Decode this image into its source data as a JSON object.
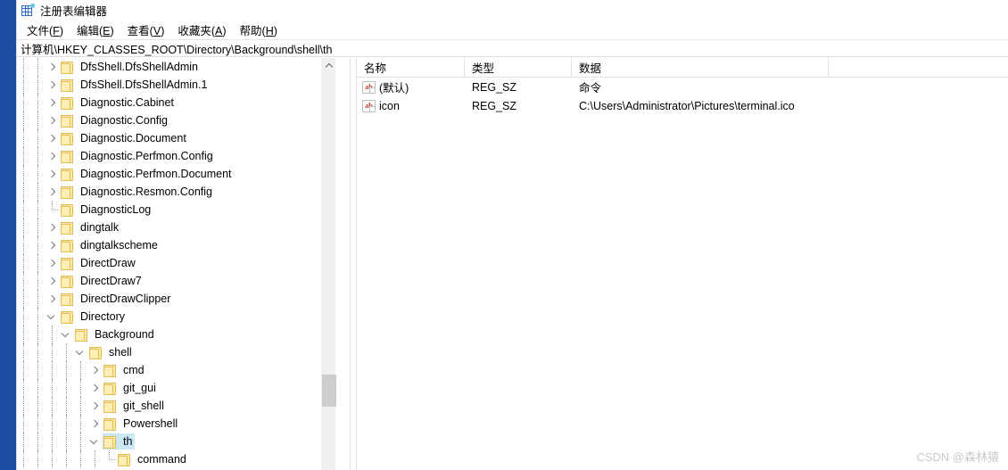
{
  "window": {
    "title": "注册表编辑器",
    "app_icon": "registry-editor-icon"
  },
  "menu": {
    "items": [
      {
        "text": "文件(F)",
        "pre": "文件(",
        "accel": "F",
        "post": ")"
      },
      {
        "text": "编辑(E)",
        "pre": "编辑(",
        "accel": "E",
        "post": ")"
      },
      {
        "text": "查看(V)",
        "pre": "查看(",
        "accel": "V",
        "post": ")"
      },
      {
        "text": "收藏夹(A)",
        "pre": "收藏夹(",
        "accel": "A",
        "post": ")"
      },
      {
        "text": "帮助(H)",
        "pre": "帮助(",
        "accel": "H",
        "post": ")"
      }
    ]
  },
  "address": {
    "path": "计算机\\HKEY_CLASSES_ROOT\\Directory\\Background\\shell\\th"
  },
  "tree": {
    "nodes": [
      {
        "label": "DfsShell.DfsShellAdmin",
        "depth": 2,
        "state": "collapsed"
      },
      {
        "label": "DfsShell.DfsShellAdmin.1",
        "depth": 2,
        "state": "collapsed"
      },
      {
        "label": "Diagnostic.Cabinet",
        "depth": 2,
        "state": "collapsed"
      },
      {
        "label": "Diagnostic.Config",
        "depth": 2,
        "state": "collapsed"
      },
      {
        "label": "Diagnostic.Document",
        "depth": 2,
        "state": "collapsed"
      },
      {
        "label": "Diagnostic.Perfmon.Config",
        "depth": 2,
        "state": "collapsed"
      },
      {
        "label": "Diagnostic.Perfmon.Document",
        "depth": 2,
        "state": "collapsed"
      },
      {
        "label": "Diagnostic.Resmon.Config",
        "depth": 2,
        "state": "collapsed"
      },
      {
        "label": "DiagnosticLog",
        "depth": 2,
        "state": "leaf"
      },
      {
        "label": "dingtalk",
        "depth": 2,
        "state": "collapsed"
      },
      {
        "label": "dingtalkscheme",
        "depth": 2,
        "state": "collapsed"
      },
      {
        "label": "DirectDraw",
        "depth": 2,
        "state": "collapsed"
      },
      {
        "label": "DirectDraw7",
        "depth": 2,
        "state": "collapsed"
      },
      {
        "label": "DirectDrawClipper",
        "depth": 2,
        "state": "collapsed"
      },
      {
        "label": "Directory",
        "depth": 2,
        "state": "expanded"
      },
      {
        "label": "Background",
        "depth": 3,
        "state": "expanded"
      },
      {
        "label": "shell",
        "depth": 4,
        "state": "expanded"
      },
      {
        "label": "cmd",
        "depth": 5,
        "state": "collapsed"
      },
      {
        "label": "git_gui",
        "depth": 5,
        "state": "collapsed"
      },
      {
        "label": "git_shell",
        "depth": 5,
        "state": "collapsed"
      },
      {
        "label": "Powershell",
        "depth": 5,
        "state": "collapsed"
      },
      {
        "label": "th",
        "depth": 5,
        "state": "expanded",
        "selected": true
      },
      {
        "label": "command",
        "depth": 6,
        "state": "leaf"
      }
    ]
  },
  "list": {
    "columns": [
      {
        "label": "名称"
      },
      {
        "label": "类型"
      },
      {
        "label": "数据"
      }
    ],
    "rows": [
      {
        "icon": "string-value-icon",
        "name": "(默认)",
        "type": "REG_SZ",
        "data": "命令"
      },
      {
        "icon": "string-value-icon",
        "name": "icon",
        "type": "REG_SZ",
        "data": "C:\\Users\\Administrator\\Pictures\\terminal.ico"
      }
    ]
  },
  "watermark": {
    "text": "CSDN @森林猿"
  },
  "colors": {
    "desktop": "#1c4fa3",
    "selection": "#cbe8f6",
    "folder": "#ffeeb4",
    "scrollbar_thumb": "#cdcdcd"
  }
}
